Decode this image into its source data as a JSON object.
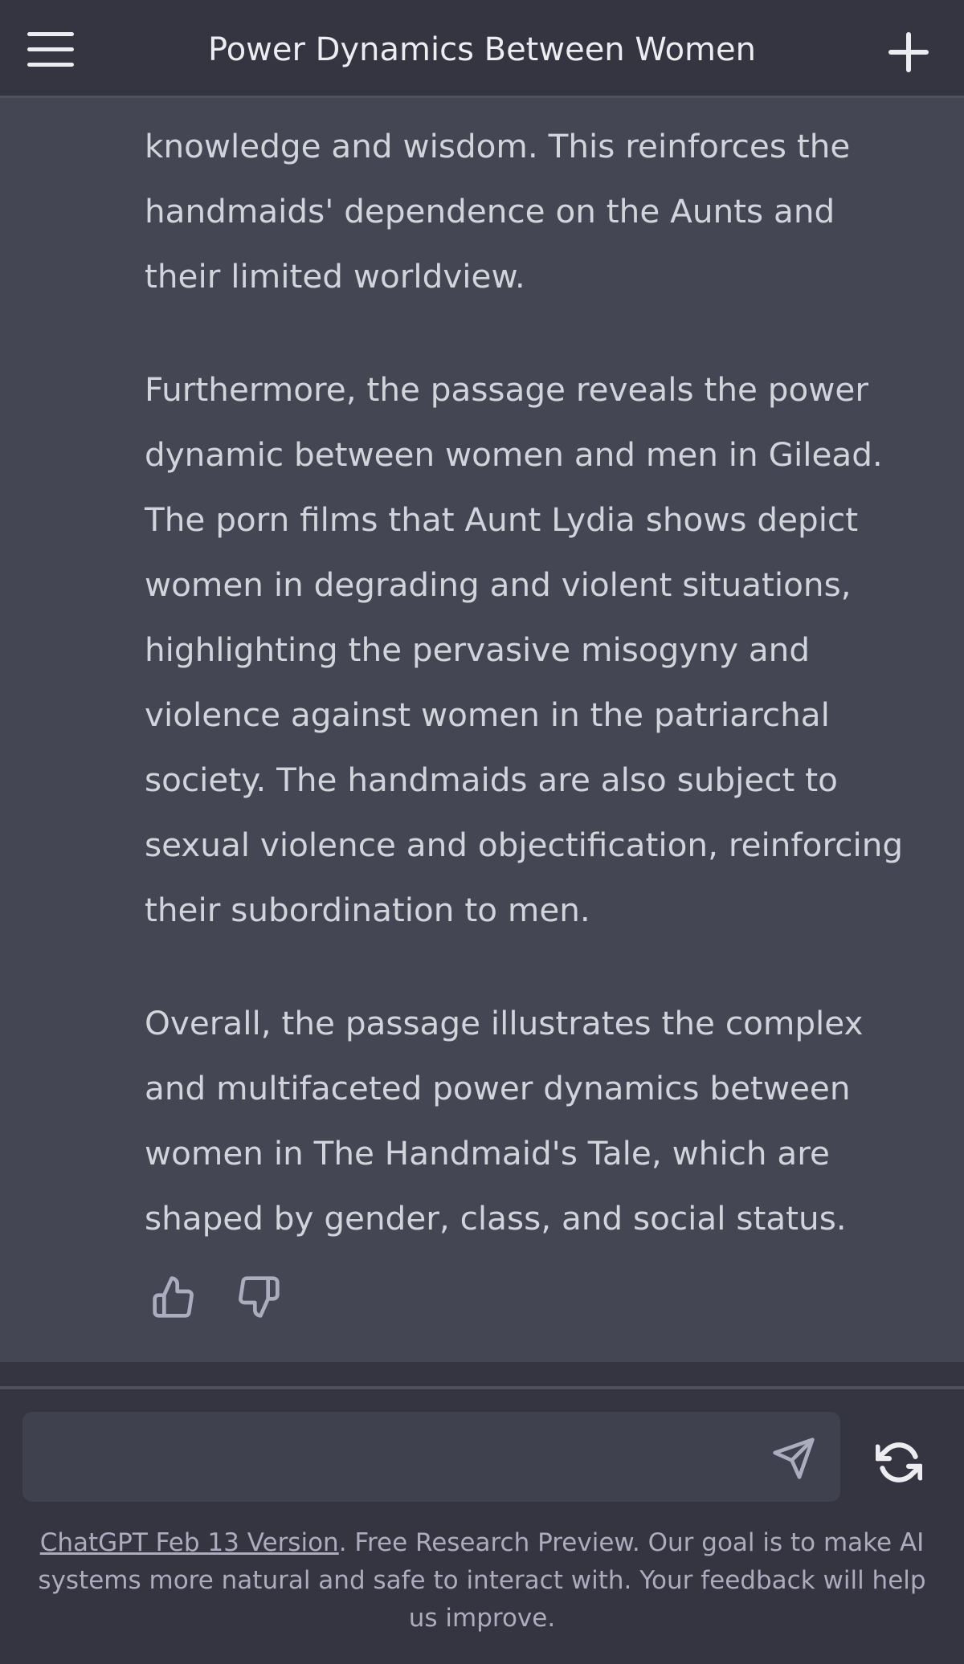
{
  "header": {
    "title": "Power Dynamics Between Women"
  },
  "message": {
    "paragraphs": [
      "knowledge and wisdom. This reinforces the handmaids' dependence on the Aunts and their limited worldview.",
      "Furthermore, the passage reveals the power dynamic between women and men in Gilead. The porn films that Aunt Lydia shows depict women in degrading and violent situations, highlighting the pervasive misogyny and violence against women in the patriarchal society. The handmaids are also subject to sexual violence and objectification, reinforcing their subordination to men.",
      "Overall, the passage illustrates the complex and multifaceted power dynamics between women in The Handmaid's Tale, which are shaped by gender, class, and social status."
    ]
  },
  "icons": {
    "menu": "hamburger-menu-icon",
    "new_chat": "plus-icon",
    "thumbs_up": "thumbs-up-icon",
    "thumbs_down": "thumbs-down-icon",
    "send": "send-icon",
    "regenerate": "regenerate-icon"
  },
  "input": {
    "value": "",
    "placeholder": ""
  },
  "footer": {
    "version_link": "ChatGPT Feb 13 Version",
    "note": ". Free Research Preview. Our goal is to make AI systems more natural and safe to interact with. Your feedback will help us improve."
  },
  "colors": {
    "background": "#343541",
    "message_background": "#444654",
    "text": "#d1d5db",
    "input_background": "#40414f"
  }
}
